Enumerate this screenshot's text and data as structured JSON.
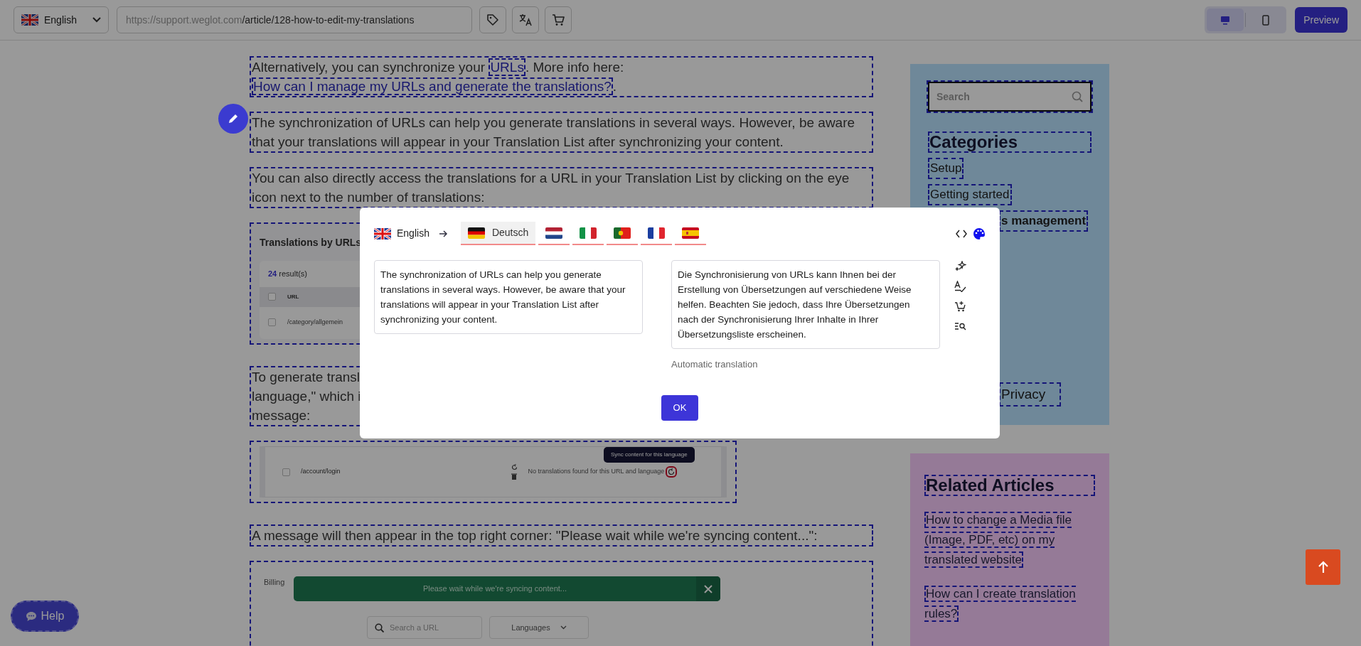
{
  "toolbar": {
    "language": {
      "label": "English"
    },
    "url": {
      "base": "https://support.weglot.com",
      "path": "/article/128-how-to-edit-my-translations"
    },
    "devices": [
      {
        "kind": "desktop",
        "selected": true
      },
      {
        "kind": "mobile",
        "selected": false
      }
    ],
    "preview": "Preview"
  },
  "article": [
    {
      "kind": "paragraph",
      "parts": [
        {
          "text": "Alternatively, you can synchronize your ",
          "link": false
        },
        {
          "text": "URLs",
          "link": true
        },
        {
          "text": ". More info here: ",
          "link": false
        },
        {
          "text": "How can I manage my URLs and generate the translations?",
          "link": true
        },
        {
          "text": ".",
          "link": false
        }
      ]
    },
    {
      "kind": "paragraph",
      "text": "The synchronization of URLs can help you generate translations in several ways. However, be aware that your translations will appear in your Translation List after synchronizing your content.",
      "editing": true
    },
    {
      "kind": "paragraph",
      "text": "You can also directly access the translations for a URL in your Translation List by clicking on the eye icon next to the number of translations:",
      "editing": false
    },
    {
      "kind": "table_shot",
      "title": "Translations by URLs",
      "count": "24",
      "count_suffix": "result(s)",
      "column": "URL",
      "row": "/category/allgemein",
      "header_checked": false,
      "row_checked": false
    },
    {
      "kind": "lines",
      "lines": [
        "To generate transl",
        "language,\" which i",
        "message:"
      ]
    },
    {
      "kind": "sync_shot",
      "url": "/account/login",
      "message": "No translations found for this URL and language",
      "tooltip": "Sync content for this language",
      "checked": false
    },
    {
      "kind": "paragraph",
      "text": "A message will then appear in the top right corner: \"Please wait while we're syncing content...\":",
      "editing": false
    },
    {
      "kind": "billing_shot",
      "tab": "Billing",
      "toast": "Please wait while we're syncing content...",
      "search_placeholder": "Search a URL",
      "dropdown": "Languages"
    }
  ],
  "sidebar": {
    "search_placeholder": "Search",
    "heading": "Categories",
    "items": [
      {
        "label": "Setup",
        "selected": false,
        "kind": "full"
      },
      {
        "label": "Getting started",
        "selected": false,
        "kind": "full"
      },
      {
        "label": "s management",
        "selected": true,
        "kind": "clipped"
      },
      {
        "label": "Privacy",
        "selected": false,
        "kind": "clipped"
      }
    ]
  },
  "related": {
    "heading": "Related Articles",
    "links": [
      "How to change a Media file (Image, PDF, etc) on my translated website",
      "How can I create translation rules?"
    ]
  },
  "help": "Help",
  "modal": {
    "source": {
      "label": "English"
    },
    "targets": [
      {
        "kind": "german",
        "label": "Deutsch",
        "selected": true
      },
      {
        "kind": "dutch",
        "selected": false
      },
      {
        "kind": "italian",
        "selected": false
      },
      {
        "kind": "portuguese",
        "selected": false
      },
      {
        "kind": "french",
        "selected": false
      },
      {
        "kind": "spanish",
        "selected": false
      }
    ],
    "source_text": "The synchronization of URLs can help you generate translations in several ways. However, be aware that your translations will appear in your Translation List after synchronizing your content.",
    "translation_text": "Die Synchronisierung von URLs kann Ihnen bei der Erstellung von Übersetzungen auf verschiedene Weise helfen. Beachten Sie jedoch, dass Ihre Übersetzungen nach der Synchronisierung Ihrer Inhalte in Ihrer Übersetzungsliste erscheinen.",
    "translation_note": "Automatic translation",
    "ok": "OK"
  }
}
